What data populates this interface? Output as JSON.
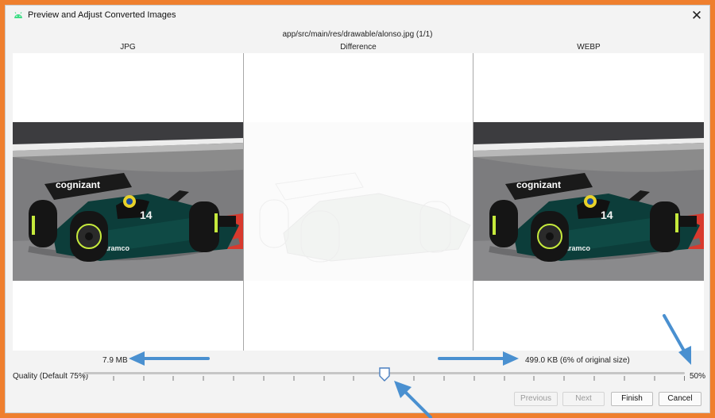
{
  "window": {
    "title": "Preview and Adjust Converted Images",
    "app_icon": "android-icon",
    "close_icon": "close-icon",
    "close_glyph": "✕"
  },
  "file_path": "app/src/main/res/drawable/alonso.jpg (1/1)",
  "columns": {
    "left": "JPG",
    "middle": "Difference",
    "right": "WEBP"
  },
  "sizes": {
    "original": "7.9 MB",
    "converted": "499.0 KB (6% of original size)"
  },
  "quality": {
    "label": "Quality (Default 75%)",
    "value_text": "50%",
    "value": 0.5
  },
  "buttons": {
    "previous": "Previous",
    "next": "Next",
    "finish": "Finish",
    "cancel": "Cancel"
  },
  "photo_text": {
    "sponsor": "cognizant",
    "number": "14",
    "brand": "aramco"
  },
  "colors": {
    "annotation_border": "#ef7f2e",
    "annotation_arrow": "#4a90d0",
    "car_green": "#0c3d3a",
    "car_lime": "#c6ea3c"
  }
}
